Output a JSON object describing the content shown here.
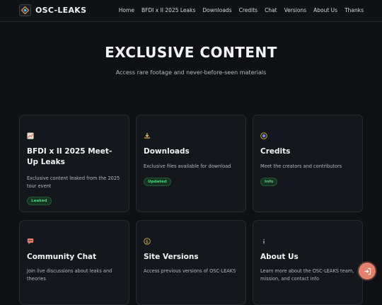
{
  "brand": {
    "name": "OSC-LEAKS"
  },
  "nav": {
    "items": [
      "Home",
      "BFDI x II 2025 Leaks",
      "Downloads",
      "Credits",
      "Chat",
      "Versions",
      "About Us",
      "Thanks"
    ]
  },
  "hero": {
    "title": "EXCLUSIVE CONTENT",
    "subtitle": "Access rare footage and never-before-seen materials"
  },
  "cards": [
    {
      "icon": "chart-icon",
      "title": "BFDI x II 2025 Meet-Up Leaks",
      "desc": "Exclusive content leaked from the 2025 tour event",
      "badge": "Leaked"
    },
    {
      "icon": "download-icon",
      "title": "Downloads",
      "desc": "Exclusive files available for download",
      "badge": "Updated"
    },
    {
      "icon": "credits-icon",
      "title": "Credits",
      "desc": "Meet the creators and contributors",
      "badge": "Info"
    },
    {
      "icon": "chat-icon",
      "title": "Community Chat",
      "desc": "Join live discussions about leaks and theories",
      "badge": ""
    },
    {
      "icon": "versions-icon",
      "title": "Site Versions",
      "desc": "Access previous versions of OSC-LEAKS",
      "badge": ""
    },
    {
      "icon": "info-icon",
      "title": "About Us",
      "desc": "Learn more about the OSC-LEAKS team, mission, and contact info",
      "badge": ""
    }
  ],
  "colors": {
    "background": "#0f1115",
    "card": "#14171c",
    "badge_green": "#4fd07c",
    "fab": "#e0826c"
  }
}
